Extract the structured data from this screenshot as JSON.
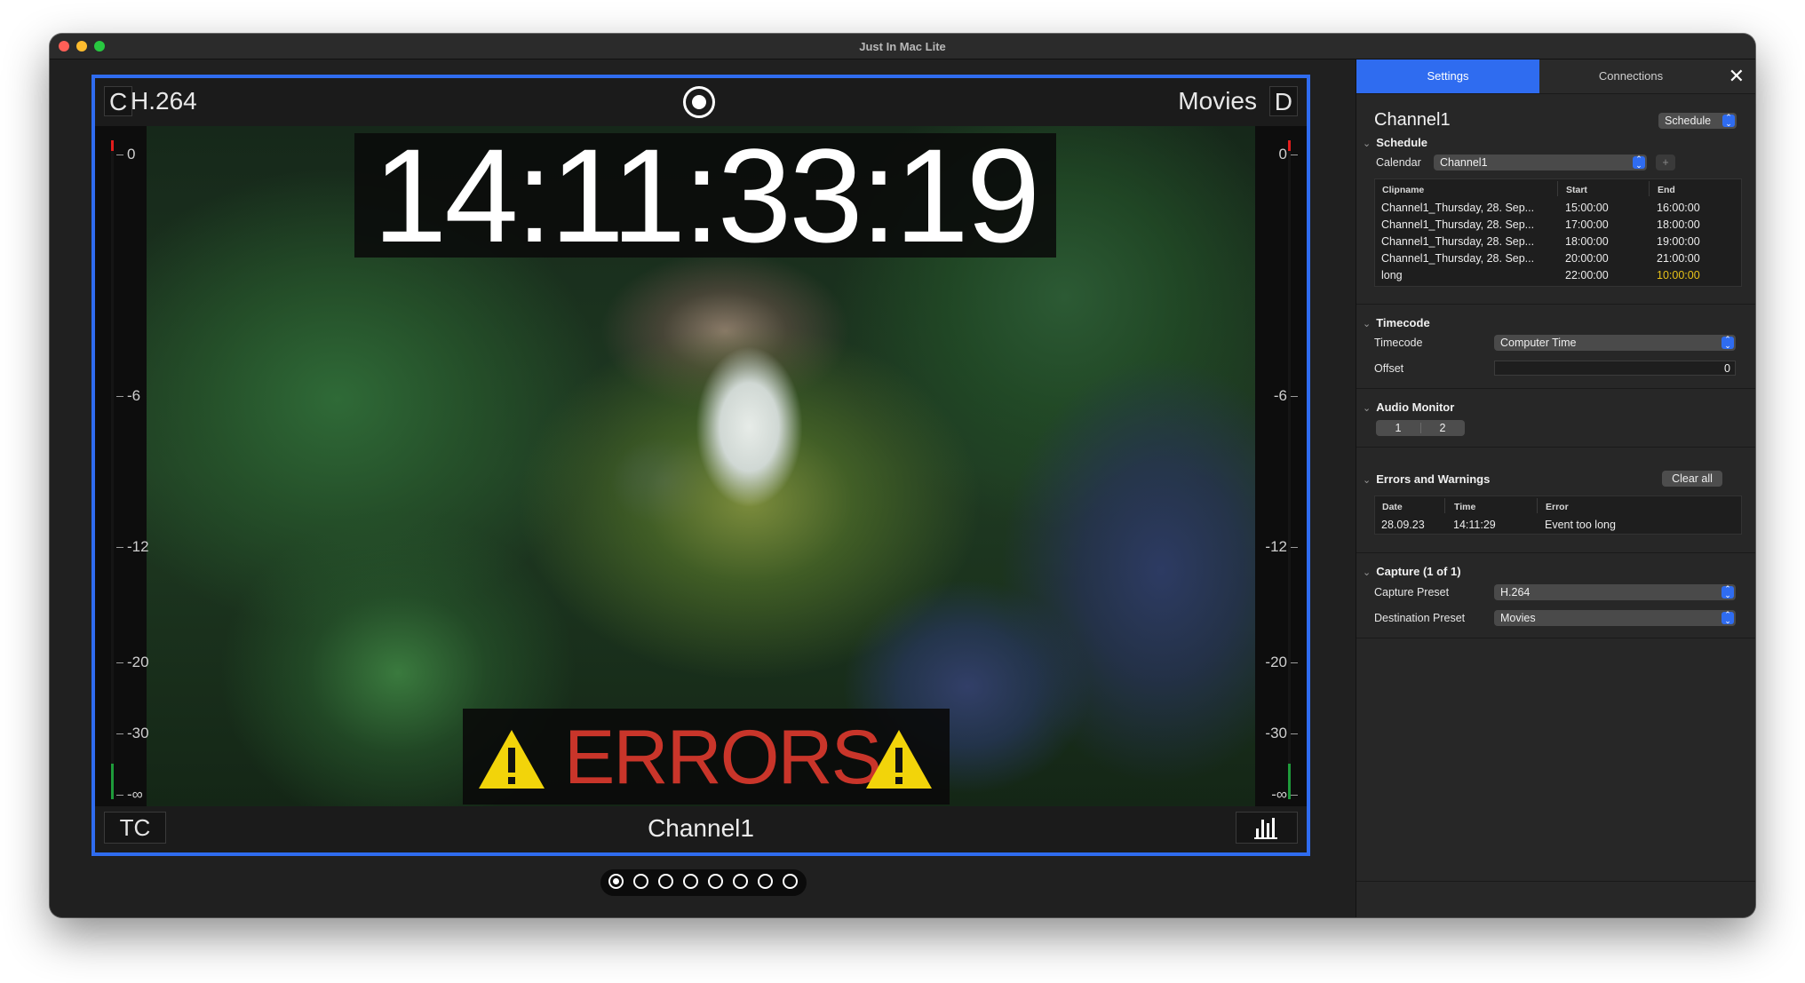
{
  "window": {
    "title": "Just In Mac Lite"
  },
  "player": {
    "left_tag": "C",
    "codec": "H.264",
    "destination": "Movies",
    "right_tag": "D",
    "timecode": "14:11:33:19",
    "errors_label": "ERRORS",
    "tc_button": "TC",
    "channel_label": "Channel1",
    "meter_scale": [
      "0",
      "-6",
      "-12",
      "-20",
      "-30",
      "-∞"
    ]
  },
  "pager": {
    "count": 8,
    "active": 0
  },
  "sidebar": {
    "tabs": [
      {
        "label": "Settings",
        "active": true
      },
      {
        "label": "Connections",
        "active": false
      }
    ],
    "channel_name": "Channel1",
    "schedule_menu": "Schedule",
    "schedule": {
      "title": "Schedule",
      "calendar_label": "Calendar",
      "calendar_value": "Channel1",
      "add_label": "+",
      "columns": [
        "Clipname",
        "Start",
        "End"
      ],
      "rows": [
        {
          "clip": "Channel1_Thursday, 28. Sep...",
          "start": "15:00:00",
          "end": "16:00:00"
        },
        {
          "clip": "Channel1_Thursday, 28. Sep...",
          "start": "17:00:00",
          "end": "18:00:00"
        },
        {
          "clip": "Channel1_Thursday, 28. Sep...",
          "start": "18:00:00",
          "end": "19:00:00"
        },
        {
          "clip": "Channel1_Thursday, 28. Sep...",
          "start": "20:00:00",
          "end": "21:00:00"
        },
        {
          "clip": "long",
          "start": "22:00:00",
          "end": "10:00:00"
        }
      ]
    },
    "timecode": {
      "title": "Timecode",
      "timecode_label": "Timecode",
      "timecode_value": "Computer Time",
      "offset_label": "Offset",
      "offset_value": "0"
    },
    "audio": {
      "title": "Audio Monitor",
      "channels": [
        "1",
        "2"
      ]
    },
    "errors": {
      "title": "Errors and Warnings",
      "clear_label": "Clear all",
      "columns": [
        "Date",
        "Time",
        "Error"
      ],
      "rows": [
        {
          "date": "28.09.23",
          "time": "14:11:29",
          "error": "Event too long"
        }
      ]
    },
    "capture": {
      "title": "Capture (1 of 1)",
      "preset_label": "Capture Preset",
      "preset_value": "H.264",
      "dest_label": "Destination Preset",
      "dest_value": "Movies"
    }
  },
  "colors": {
    "accent": "#2f6cf0",
    "error_text": "#c9352a",
    "warning_yellow": "#f2d40a",
    "highlight_time": "#e8c219"
  }
}
